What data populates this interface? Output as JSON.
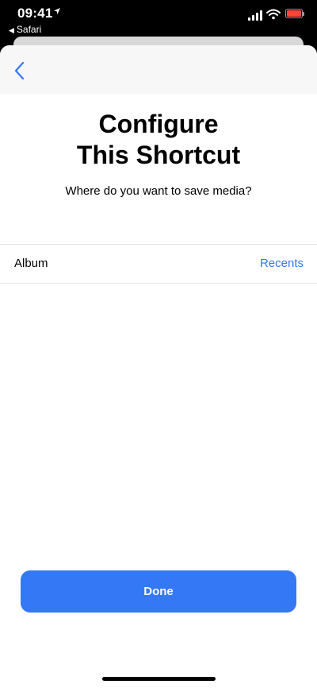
{
  "status_bar": {
    "time": "09:41",
    "back_app": "Safari",
    "battery_color": "#ff453a"
  },
  "sheet": {
    "back_icon": "chevron-left-icon",
    "title_line1": "Configure",
    "title_line2": "This Shortcut",
    "subtitle": "Where do you want to save media?"
  },
  "setting_row": {
    "label": "Album",
    "value": "Recents"
  },
  "done_button": {
    "label": "Done",
    "color": "#3478f6"
  }
}
